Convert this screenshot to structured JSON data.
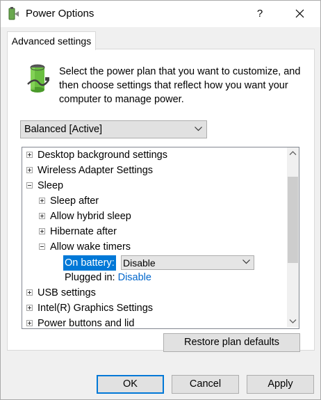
{
  "window": {
    "title": "Power Options",
    "help": "?",
    "accent_color": "#0078d7"
  },
  "tab": {
    "label": "Advanced settings"
  },
  "description": "Select the power plan that you want to customize, and then choose settings that reflect how you want your computer to manage power.",
  "plan_select": {
    "value": "Balanced [Active]"
  },
  "tree": {
    "items": [
      {
        "label": "Desktop background settings",
        "state": "collapsed"
      },
      {
        "label": "Wireless Adapter Settings",
        "state": "collapsed"
      },
      {
        "label": "Sleep",
        "state": "expanded"
      },
      {
        "label": "Sleep after",
        "state": "collapsed"
      },
      {
        "label": "Allow hybrid sleep",
        "state": "collapsed"
      },
      {
        "label": "Hibernate after",
        "state": "collapsed"
      },
      {
        "label": "Allow wake timers",
        "state": "expanded"
      },
      {
        "label": "USB settings",
        "state": "collapsed"
      },
      {
        "label": "Intel(R) Graphics Settings",
        "state": "collapsed"
      },
      {
        "label": "Power buttons and lid",
        "state": "collapsed"
      }
    ],
    "on_battery": {
      "label": "On battery:",
      "value": "Disable"
    },
    "plugged_in": {
      "label": "Plugged in:",
      "value": "Disable"
    }
  },
  "buttons": {
    "restore": "Restore plan defaults",
    "ok": "OK",
    "cancel": "Cancel",
    "apply": "Apply"
  }
}
